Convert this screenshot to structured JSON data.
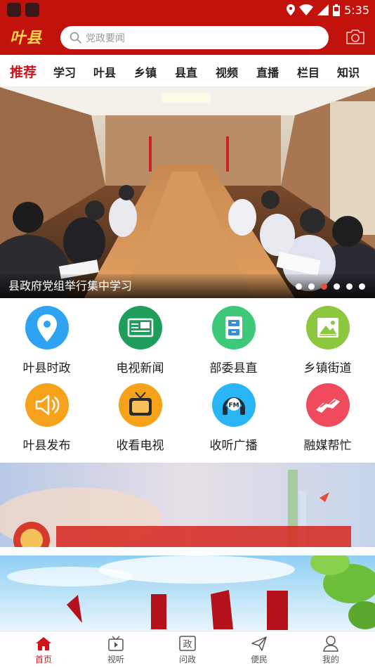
{
  "status_bar": {
    "time": "5:35"
  },
  "header": {
    "logo": "叶县",
    "search_placeholder": "党政要闻"
  },
  "tabs": [
    "推荐",
    "学习",
    "叶县",
    "乡镇",
    "县直",
    "视频",
    "直播",
    "栏目",
    "知识"
  ],
  "banner": {
    "title": "县政府党组举行集中学习",
    "dot_count": 6,
    "active_dot": 2
  },
  "grid": [
    {
      "label": "叶县时政",
      "color": "#2ea3f2",
      "icon": "location-pin-icon"
    },
    {
      "label": "电视新闻",
      "color": "#1e9e5a",
      "icon": "news-tv-icon"
    },
    {
      "label": "部委县直",
      "color": "#3ec97a",
      "icon": "cabinet-icon"
    },
    {
      "label": "乡镇街道",
      "color": "#8dc63f",
      "icon": "landscape-icon"
    },
    {
      "label": "叶县发布",
      "color": "#f7a21b",
      "icon": "speaker-icon"
    },
    {
      "label": "收看电视",
      "color": "#f7a21b",
      "icon": "television-icon"
    },
    {
      "label": "收听广播",
      "color": "#29b6f6",
      "icon": "radio-fm-icon"
    },
    {
      "label": "融媒帮忙",
      "color": "#ef4b5c",
      "icon": "helping-hands-icon"
    }
  ],
  "bottom_nav": [
    {
      "label": "首页",
      "icon": "home-icon",
      "active": true
    },
    {
      "label": "视听",
      "icon": "video-play-icon",
      "active": false
    },
    {
      "label": "问政",
      "icon": "zheng-icon",
      "active": false,
      "glyph": "政"
    },
    {
      "label": "便民",
      "icon": "send-icon",
      "active": false
    },
    {
      "label": "我的",
      "icon": "user-icon",
      "active": false
    }
  ],
  "colors": {
    "brand_red": "#c2120c",
    "tab_active": "#d0121b",
    "logo_gold": "#ffd54a"
  }
}
